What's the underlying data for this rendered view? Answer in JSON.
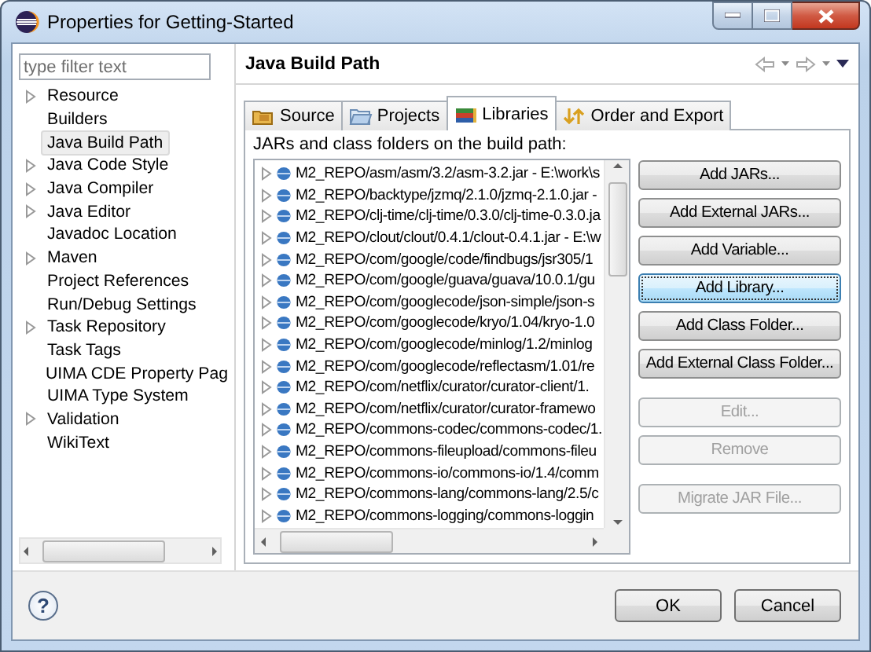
{
  "window": {
    "title": "Properties for Getting-Started"
  },
  "filter": {
    "placeholder": "type filter text"
  },
  "tree": {
    "items": [
      {
        "label": "Resource",
        "expandable": true,
        "selected": false
      },
      {
        "label": "Builders",
        "expandable": false,
        "selected": false
      },
      {
        "label": "Java Build Path",
        "expandable": false,
        "selected": true
      },
      {
        "label": "Java Code Style",
        "expandable": true,
        "selected": false
      },
      {
        "label": "Java Compiler",
        "expandable": true,
        "selected": false
      },
      {
        "label": "Java Editor",
        "expandable": true,
        "selected": false
      },
      {
        "label": "Javadoc Location",
        "expandable": false,
        "selected": false
      },
      {
        "label": "Maven",
        "expandable": true,
        "selected": false
      },
      {
        "label": "Project References",
        "expandable": false,
        "selected": false
      },
      {
        "label": "Run/Debug Settings",
        "expandable": false,
        "selected": false
      },
      {
        "label": "Task Repository",
        "expandable": true,
        "selected": false
      },
      {
        "label": "Task Tags",
        "expandable": false,
        "selected": false
      },
      {
        "label": "UIMA CDE Property Pag",
        "expandable": false,
        "selected": false
      },
      {
        "label": "UIMA Type System",
        "expandable": false,
        "selected": false
      },
      {
        "label": "Validation",
        "expandable": true,
        "selected": false
      },
      {
        "label": "WikiText",
        "expandable": false,
        "selected": false
      }
    ]
  },
  "page": {
    "title": "Java Build Path"
  },
  "tabs": [
    {
      "label": "Source",
      "kind": "source",
      "selected": false
    },
    {
      "label": "Projects",
      "kind": "projects",
      "selected": false
    },
    {
      "label": "Libraries",
      "kind": "libraries",
      "selected": true
    },
    {
      "label": "Order and Export",
      "kind": "order",
      "selected": false
    }
  ],
  "list_label": "JARs and class folders on the build path:",
  "libraries": [
    {
      "label": "M2_REPO/asm/asm/3.2/asm-3.2.jar - E:\\work\\s",
      "expandable": true
    },
    {
      "label": "M2_REPO/backtype/jzmq/2.1.0/jzmq-2.1.0.jar -",
      "expandable": true
    },
    {
      "label": "M2_REPO/clj-time/clj-time/0.3.0/clj-time-0.3.0.ja",
      "expandable": true
    },
    {
      "label": "M2_REPO/clout/clout/0.4.1/clout-0.4.1.jar - E:\\w",
      "expandable": true
    },
    {
      "label": "M2_REPO/com/google/code/findbugs/jsr305/1",
      "expandable": true
    },
    {
      "label": "M2_REPO/com/google/guava/guava/10.0.1/gu",
      "expandable": true
    },
    {
      "label": "M2_REPO/com/googlecode/json-simple/json-s",
      "expandable": true
    },
    {
      "label": "M2_REPO/com/googlecode/kryo/1.04/kryo-1.0",
      "expandable": true
    },
    {
      "label": "M2_REPO/com/googlecode/minlog/1.2/minlog",
      "expandable": true
    },
    {
      "label": "M2_REPO/com/googlecode/reflectasm/1.01/re",
      "expandable": true
    },
    {
      "label": "M2_REPO/com/netflix/curator/curator-client/1.",
      "expandable": true
    },
    {
      "label": "M2_REPO/com/netflix/curator/curator-framewo",
      "expandable": true
    },
    {
      "label": "M2_REPO/commons-codec/commons-codec/1.",
      "expandable": true
    },
    {
      "label": "M2_REPO/commons-fileupload/commons-fileu",
      "expandable": true
    },
    {
      "label": "M2_REPO/commons-io/commons-io/1.4/comm",
      "expandable": true
    },
    {
      "label": "M2_REPO/commons-lang/commons-lang/2.5/c",
      "expandable": true
    },
    {
      "label": "M2_REPO/commons-logging/commons-loggin",
      "expandable": true
    }
  ],
  "button_groups": [
    [
      {
        "label": "Add JARs...",
        "disabled": false,
        "focused": false
      },
      {
        "label": "Add External JARs...",
        "disabled": false,
        "focused": false
      },
      {
        "label": "Add Variable...",
        "disabled": false,
        "focused": false
      },
      {
        "label": "Add Library...",
        "disabled": false,
        "focused": true
      },
      {
        "label": "Add Class Folder...",
        "disabled": false,
        "focused": false
      },
      {
        "label": "Add External Class Folder...",
        "disabled": false,
        "focused": false
      }
    ],
    [
      {
        "label": "Edit...",
        "disabled": true,
        "focused": false
      },
      {
        "label": "Remove",
        "disabled": true,
        "focused": false
      }
    ],
    [
      {
        "label": "Migrate JAR File...",
        "disabled": true,
        "focused": false
      }
    ]
  ],
  "footer": {
    "help": "?",
    "buttons": [
      {
        "label": "OK"
      },
      {
        "label": "Cancel"
      }
    ]
  }
}
